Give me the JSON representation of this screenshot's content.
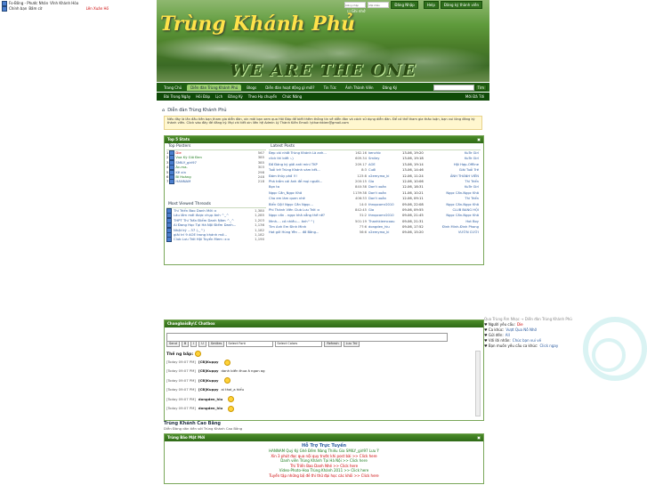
{
  "status": {
    "line1_left": "Fo-Bông - Phước Nhân",
    "line1_right": "Vĩnh Khánh Hòa",
    "line2_left": "Chính bạn",
    "line2_mid": "Bấm cờ",
    "line2_right": "Lên Xuân Hồ"
  },
  "banner": {
    "title": "Trùng Khánh Phủ",
    "slogan": "WE ARE THE ONE",
    "login_user_placeholder": "Đăng nhập",
    "login_pass_placeholder": "Mật khẩu",
    "login_button": "Đăng Nhập",
    "help_button": "Help",
    "register_button": "Đăng ký thành viên",
    "remember": "Ghi nhớ"
  },
  "nav": {
    "tabs": [
      "Trang Chủ",
      "Diễn đàn Trùng Khánh Phủ",
      "Blogs",
      "Diễn đàn hoạt động gì mới?",
      "Tin Tức",
      "Ảnh Thành Viên",
      "Đăng Ký"
    ],
    "active_index": 1,
    "search_button": "Tìm",
    "search_right": "Mới Đã Tới"
  },
  "subnav": [
    "Bài Trong Ngày",
    "Hỏi Đáp",
    "Lịch",
    "Đăng Ký",
    "Theo Hạ chuyển",
    "Chức Năng"
  ],
  "breadcrumb": "Diễn đàn Trùng Khánh Phủ",
  "notice": {
    "text": "Nếu đây là lần đầu tiên bạn tham gia diễn đàn, xin mời bạn xem qua Hỏi Đáp để biết thêm thông tin về diễn đàn và cách sử dụng diễn đàn. Để có thể tham gia thảo luận, bạn vui lòng đăng ký thành viên. Click vào đây để đăng ký. Mọi chi tiết xin liên hệ Admin Lý Thành Kiên Email: lythanhkien@gmail.com"
  },
  "topstats": {
    "title": "Top 5 Stats",
    "top_posters_label": "Top Posters",
    "most_viewed_label": "Most Viewed Threads",
    "latest_posts_label": "Latest Posts",
    "posters": [
      {
        "rank": "1",
        "name": "Die",
        "count": "567"
      },
      {
        "rank": "2",
        "name": "Vua Kỳ Gió Đen",
        "count": "385"
      },
      {
        "rank": "3",
        "name": "SMILY_girl97",
        "count": "385"
      },
      {
        "rank": "4",
        "name": "Ác-ma-",
        "count": "303"
      },
      {
        "rank": "5",
        "name": "Kê xin",
        "count": "298"
      },
      {
        "rank": "6",
        "name": "Bí Hoàng",
        "count": "248"
      },
      {
        "rank": "7",
        "name": "HANNAM",
        "count": "218"
      }
    ],
    "viewed": [
      {
        "title": "Thi Triển Bao Danh Mới :x",
        "count": "1,380"
      },
      {
        "title": "Lâu lắm mới được chụp ảnh ^_^",
        "count": "1,285"
      },
      {
        "title": "THPT Thi Trấn Điểm Danh Năm ^_^",
        "count": "1,203"
      },
      {
        "title": "Ai Đang Học Tại Hà Nội Điểm Danh...",
        "count": "1,136"
      },
      {
        "title": "Nhật ký ...37 (-_^)",
        "count": "1,182"
      },
      {
        "title": "giải trí 9 AOE trong khánh mở...",
        "count": "1,182"
      },
      {
        "title": "Club Lưu Trời Hội Tuyển Mem :x:x",
        "count": "1,190"
      }
    ],
    "latest": [
      {
        "title": "Đẹp cái nhất Trùng Khánh Là anh...",
        "views": "162.16",
        "user": "kenchic",
        "date": "13-06, 19:20",
        "last": "KuTe Girl"
      },
      {
        "title": "click thì biết :-)",
        "views": "609.34",
        "user": "Smiley",
        "date": "13-06, 19:18",
        "last": "KuTe Girl"
      },
      {
        "title": "Đồ Đáng ký giải anti mini TKP",
        "views": "209.17",
        "user": "AOE",
        "date": "13-06, 19:14",
        "last": "Hội Hợp-Offline"
      },
      {
        "title": "Tuổi trẻ Trùng Khánh vàm kết...",
        "views": "8:3",
        "user": "Cuối",
        "date": "13-06, 14:46",
        "last": "Giải Tuổi Trẻ"
      },
      {
        "title": "Đám thủy phố !!!",
        "views": "123:8",
        "user": "x2emyma_ki",
        "date": "12-06, 11:24",
        "last": "ẢNH THÀNH VIÊN"
      },
      {
        "title": "Phá trắm cái ảnh để mọi người...",
        "views": "200:15",
        "user": "Gia",
        "date": "12-06, 10:06",
        "last": "Thi Triển"
      },
      {
        "title": "Bọn ta",
        "views": "840:38",
        "user": "Don't xoắn",
        "date": "12-06, 18:31",
        "last": "KuTe Girl"
      },
      {
        "title": "Ngọc Cần_Ngọc Khả",
        "views": "1139:38",
        "user": "Don't xoắn",
        "date": "11-06, 10:21",
        "last": "Ngọc Cần-Ngọc Khả"
      },
      {
        "title": "Cho em làm quen nhé",
        "views": "406:33",
        "user": "Don't xoắn",
        "date": "12-06, 09:11",
        "last": "Thi Triển"
      },
      {
        "title": "Biển Gội! Ngọc Cần Ngọc...",
        "views": "14:0",
        "user": "thropcomr2010",
        "date": "09-06, 22:08",
        "last": "Ngọc Cần-Ngọc Khả"
      },
      {
        "title": "Phi Thành Viên Club Lưu Trời :x",
        "views": "842:45",
        "user": "Gia",
        "date": "09-06, 09:55",
        "last": "CLUB BANG HỘI"
      },
      {
        "title": "Ngọc cần - ngọc khả vẳng thế nê?",
        "views": "31:2",
        "user": "thropcomr2010",
        "date": "09-06, 21:45",
        "last": "Ngọc Cần-Ngọc Khả"
      },
      {
        "title": "Mmh.... có nhiều.... ânh^^)",
        "views": "501:19",
        "user": "Thanhkiemcoau",
        "date": "09-06, 21:31",
        "last": "Hot Boy"
      },
      {
        "title": "Tìm Anh Em Đình Minh",
        "views": "77:6",
        "user": "dongden_hiu",
        "date": "09-06, 17:52",
        "last": "Đình Minh-Đình Phong"
      },
      {
        "title": "Hot gửi Hùng Yên ... đồ Bằng...",
        "views": "56:6",
        "user": "x2emyma_ki",
        "date": "09-06, 15:20",
        "last": "VƯỜN CƯỜI"
      }
    ]
  },
  "chatbox": {
    "title": "ChangbaisBy\\C Chatbox",
    "buttons": [
      "Send",
      "B",
      "I",
      "U",
      "Smilies"
    ],
    "font_select": "Select Font",
    "color_select": "Select Colors",
    "refresh": "Refresh",
    "history": "Lưu Trữ",
    "intro_label": "Thế ng bắp:",
    "messages": [
      {
        "time": "[Today 09:07 PM]",
        "user": "[CB]Kuppy",
        "text": ""
      },
      {
        "time": "[Today 09:07 PM]",
        "user": "[CB]Kuppy",
        "text": "danh biến thua ả ngon ag"
      },
      {
        "time": "[Today 09:07 PM]",
        "user": "[CB]Kuppy",
        "text": ""
      },
      {
        "time": "[Today 09:07 PM]",
        "user": "[CB]Kuppy",
        "text": "ai thơi_a hiểu"
      },
      {
        "time": "[Today 09:07 PM]",
        "user": "dongden_hiu",
        "text": ""
      },
      {
        "time": "[Today 09:07 PM]",
        "user": "dongden_hiu",
        "text": ""
      }
    ]
  },
  "group": {
    "title": "Trùng Khánh Cao Bằng",
    "subtitle": "Diễn Đàng dân tiền với Trùng Khánh Cao Bằng"
  },
  "hotbox": {
    "head": "Trùng Bảo Mật Mới",
    "title": "Hỗ Trợ Trực Tuyến",
    "lines": [
      "HANNAM Quỷ Ký Ghé Đêm Nàng Thiếu Gia SMILY_girl97 Lưu Ý",
      "Xin 3 phút đọc qua nội quy trước khi post bài >> Click here",
      "Danh viên Trùng Khánh Tại Hà Nội >> Click here",
      "Thi Triển Bao Danh Nhé >> Click here",
      "Video-Photo-Hoa Trùng Khánh 2011 >> Click here",
      "Tuyển tập những bộ đề thi thử đại học các khối >> Click here"
    ]
  },
  "right_widget": {
    "breadcrumb": "Qua Trùng Âm Nhạc → Diễn đàn Trùng Khánh Phủ",
    "rows": [
      {
        "label": "Người yêu cầu:",
        "value": "Die"
      },
      {
        "label": "Ca khúc:",
        "value": "Vượt Qua Nỗ Nhớ"
      },
      {
        "label": "Gửi đến:",
        "value": "All"
      },
      {
        "label": "Với lời nhắn:",
        "value": "Chúc bạn vui vẻ"
      },
      {
        "label": "Bạn muốn yêu cầu ca khúc:",
        "value": "Click ngay"
      }
    ]
  },
  "colors": {
    "brand": "#2e6a17",
    "accent": "#ffe24a",
    "link": "#2a5a9e",
    "alert": "#c00000"
  }
}
